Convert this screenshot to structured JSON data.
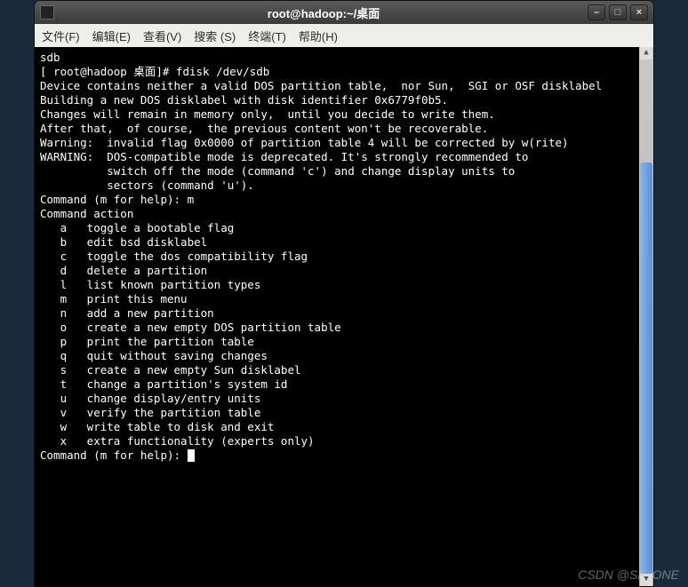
{
  "window": {
    "title": "root@hadoop:~/桌面"
  },
  "menubar": {
    "file": "文件(F)",
    "edit": "编辑(E)",
    "view": "查看(V)",
    "search": "搜索 (S)",
    "terminal": "终端(T)",
    "help": "帮助(H)"
  },
  "terminal": {
    "lines": [
      "sdb",
      "[ root@hadoop 桌面]# fdisk /dev/sdb",
      "Device contains neither a valid DOS partition table,  nor Sun,  SGI or OSF disklabel",
      "Building a new DOS disklabel with disk identifier 0x6779f0b5.",
      "Changes will remain in memory only,  until you decide to write them.",
      "After that,  of course,  the previous content won't be recoverable.",
      "",
      "Warning:  invalid flag 0x0000 of partition table 4 will be corrected by w(rite)",
      "",
      "WARNING:  DOS-compatible mode is deprecated. It's strongly recommended to",
      "          switch off the mode (command 'c') and change display units to",
      "          sectors (command 'u').",
      "",
      "Command (m for help): m",
      "Command action",
      "   a   toggle a bootable flag",
      "   b   edit bsd disklabel",
      "   c   toggle the dos compatibility flag",
      "   d   delete a partition",
      "   l   list known partition types",
      "   m   print this menu",
      "   n   add a new partition",
      "   o   create a new empty DOS partition table",
      "   p   print the partition table",
      "   q   quit without saving changes",
      "   s   create a new empty Sun disklabel",
      "   t   change a partition's system id",
      "   u   change display/entry units",
      "   v   verify the partition table",
      "   w   write table to disk and exit",
      "   x   extra functionality (experts only)",
      "",
      "Command (m for help): "
    ]
  },
  "watermark": "CSDN @SF_ONE"
}
